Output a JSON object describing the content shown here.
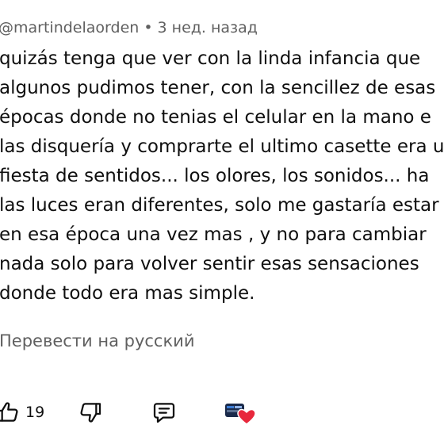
{
  "comment": {
    "author": "@martindelaorden",
    "separator": "•",
    "time": "3 нед. назад",
    "lines": [
      "quizás tenga que ver con la linda infancia que",
      "algunos pudimos tener, con la sencillez de esas",
      "épocas donde no tenias el celular en la mano e",
      "las disquería y comprarte el ultimo casette era u",
      "fiesta de sentidos... los olores, los sonidos... ha",
      "las luces eran diferentes, solo me gastaría estar",
      "en esa época una vez mas , y no para cambiar",
      "nada solo para volver sentir esas sensaciones",
      "donde todo era mas simple."
    ],
    "translate_label": "Перевести на русский"
  },
  "actions": {
    "like_count": "19",
    "icons": {
      "like": "thumbs-up-icon",
      "dislike": "thumbs-down-icon",
      "reply": "reply-comment-icon",
      "creator_heart": "creator-heart-icon"
    }
  },
  "colors": {
    "text": "#0f0f0f",
    "secondary": "#606060",
    "heart": "#e8283c"
  }
}
